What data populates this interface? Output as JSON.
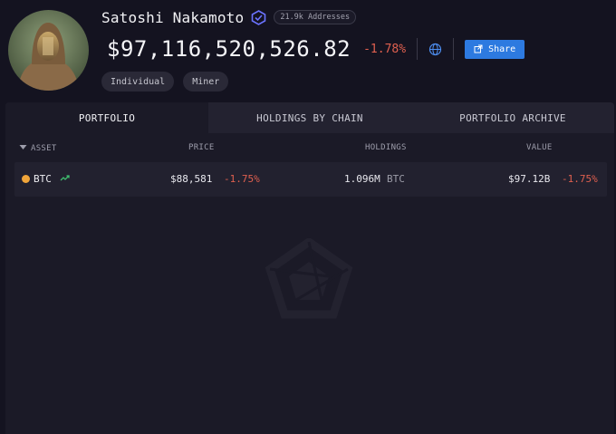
{
  "profile": {
    "name": "Satoshi Nakamoto",
    "addresses_badge": "21.9k Addresses",
    "total_value": "$97,116,520,526.82",
    "total_change": "-1.78%",
    "share_label": "Share",
    "tags": [
      "Individual",
      "Miner"
    ]
  },
  "tabs": [
    {
      "label": "PORTFOLIO",
      "active": true
    },
    {
      "label": "HOLDINGS BY CHAIN",
      "active": false
    },
    {
      "label": "PORTFOLIO ARCHIVE",
      "active": false
    }
  ],
  "table": {
    "headers": {
      "asset": "ASSET",
      "price": "PRICE",
      "holdings": "HOLDINGS",
      "value": "VALUE"
    },
    "rows": [
      {
        "asset": "BTC",
        "icon": "bitcoin-icon",
        "price": "$88,581",
        "price_change": "-1.75%",
        "holdings": "1.096M",
        "holdings_unit": "BTC",
        "value": "$97.12B",
        "value_change": "-1.75%"
      }
    ]
  },
  "colors": {
    "background": "#141320",
    "panel": "#1b1a27",
    "accent": "#2d7ae0",
    "negative": "#e0604f",
    "btc": "#f0a53a",
    "verified": "#6b73ff"
  }
}
